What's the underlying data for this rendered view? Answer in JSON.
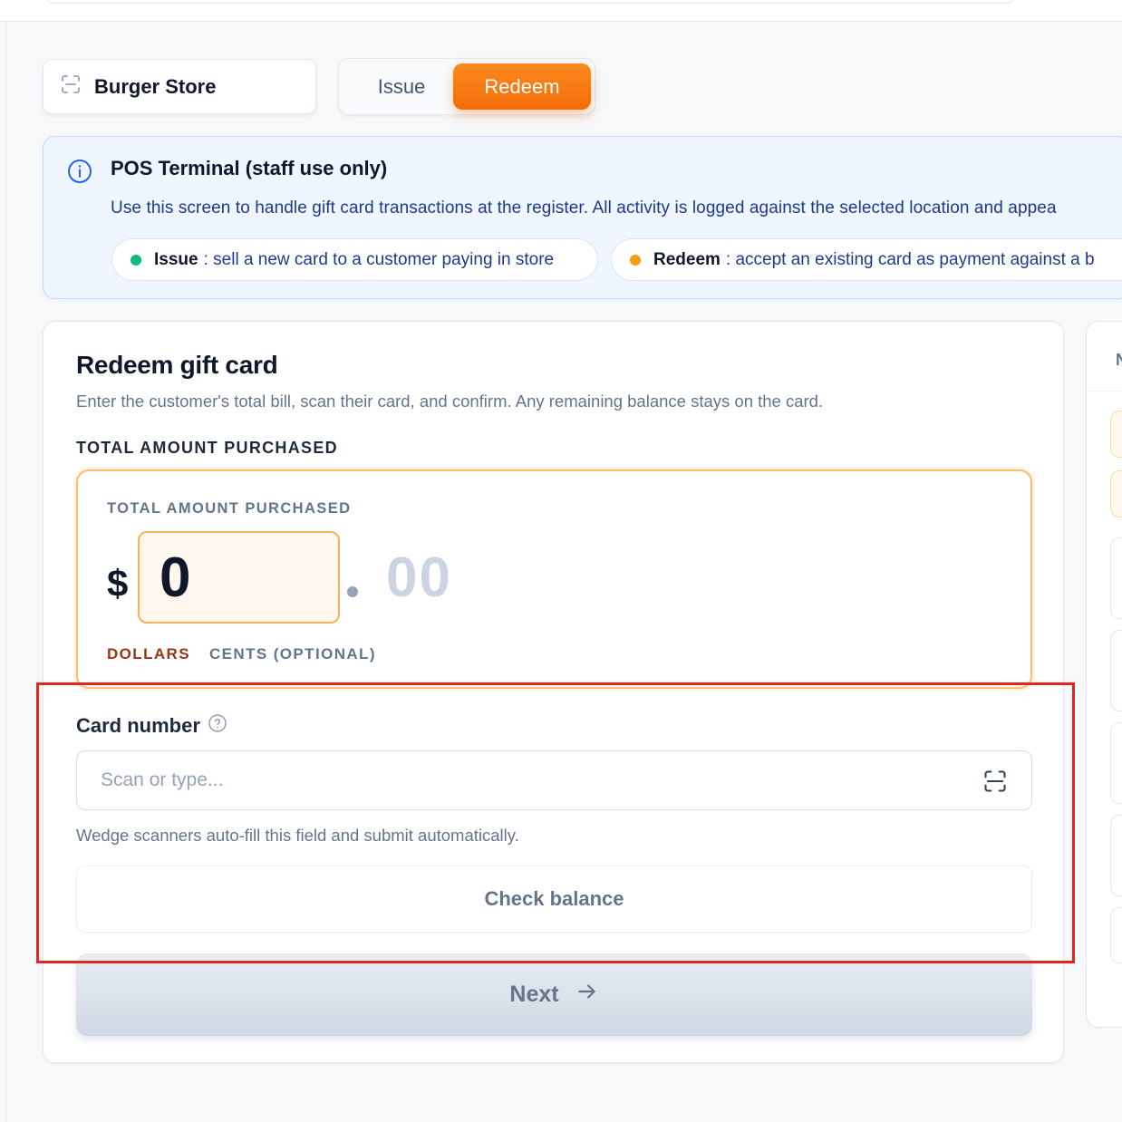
{
  "store_selector": {
    "label": "Burger Store",
    "icon": "scan-icon"
  },
  "mode_toggle": {
    "issue_label": "Issue",
    "redeem_label": "Redeem",
    "selected": "Redeem"
  },
  "banner": {
    "icon": "info-icon",
    "title": "POS Terminal (staff use only)",
    "description": "Use this screen to handle gift card transactions at the register. All activity is logged against the selected location and appea",
    "chips": [
      {
        "key": "Issue",
        "text": ": sell a new card to a customer paying in store",
        "dot_color": "#10b981"
      },
      {
        "key": "Redeem",
        "text": ": accept an existing card as payment against a b",
        "dot_color": "#f59e0b"
      }
    ]
  },
  "redeem_card": {
    "title": "Redeem gift card",
    "subtitle": "Enter the customer's total bill, scan their card, and confirm. Any remaining balance stays on the card.",
    "section_label": "TOTAL AMOUNT PURCHASED",
    "amount": {
      "inner_label": "TOTAL AMOUNT PURCHASED",
      "currency": "$",
      "dollars": "0",
      "cents_placeholder": "00",
      "dollars_label": "DOLLARS",
      "cents_label": "CENTS (OPTIONAL)"
    },
    "card_number": {
      "label": "Card number",
      "placeholder": "Scan or type...",
      "value": "",
      "hint": "Wedge scanners auto-fill this field and submit automatically."
    },
    "check_balance_label": "Check balance",
    "next_label": "Next"
  },
  "side_panel": {
    "header_letter": "N"
  },
  "colors": {
    "accent_orange": "#f97316",
    "banner_bg": "#eff6ff",
    "highlight_red": "#e0261f"
  }
}
